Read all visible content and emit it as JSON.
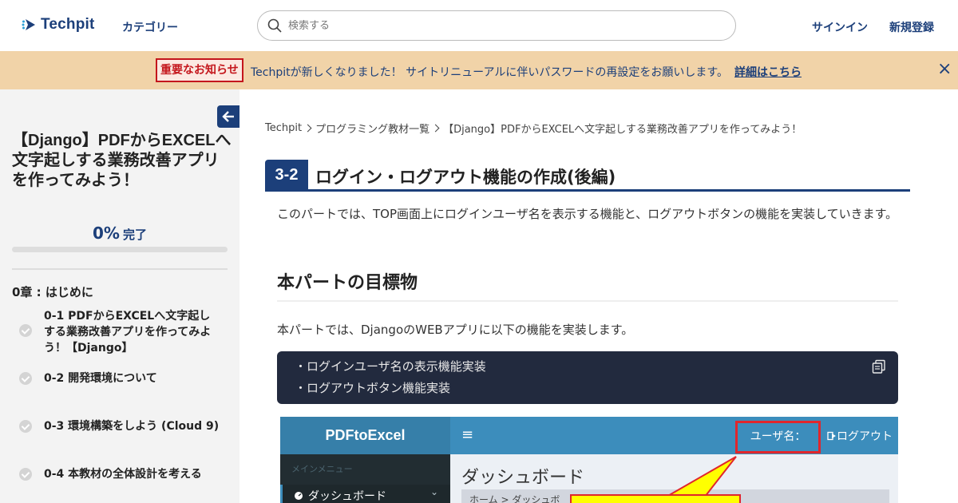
{
  "header": {
    "logo_text": "Techpit",
    "category": "カテゴリー",
    "search_placeholder": "検索する",
    "signin": "サインイン",
    "signup": "新規登録"
  },
  "notice": {
    "badge": "重要なお知らせ",
    "text": "Techpitが新しくなりました！ サイトリニューアルに伴いパスワードの再設定をお願いします。",
    "link": "詳細はこちら",
    "close": "×"
  },
  "sidebar": {
    "course_title": "【Django】PDFからEXCELへ文字起しする業務改善アプリを作ってみよう！",
    "progress_pct": "0%",
    "progress_value": 0,
    "progress_done": "完了",
    "chapter": "0章 : はじめに",
    "lessons": [
      {
        "label": "0-1 PDFからEXCELへ文字起しする業務改善アプリを作ってみよう！【Django】"
      },
      {
        "label": "0-2 開発環境について"
      },
      {
        "label": "0-3 環境構築をしよう (Cloud 9)"
      },
      {
        "label": "0-4 本教材の全体設計を考える"
      }
    ]
  },
  "breadcrumb": {
    "items": [
      "Techpit",
      "プログラミング教材一覧",
      "【Django】PDFからEXCELへ文字起しする業務改善アプリを作ってみよう！"
    ]
  },
  "section": {
    "number": "3-2",
    "title": "ログイン・ログアウト機能の作成(後編)"
  },
  "content": {
    "intro": "このパートでは、TOP画面上にログインユーザ名を表示する機能と、ログアウトボタンの機能を実装していきます。",
    "h2": "本パートの目標物",
    "para2": "本パートでは、DjangoのWEBアプリに以下の機能を実装します。",
    "code_lines": [
      "・ログインユーザ名の表示機能実装",
      "・ログアウトボタン機能実装"
    ]
  },
  "screenshot": {
    "brand": "PDFtoExcel",
    "menu_glyph": "≡",
    "user_label": "ユーザ名：",
    "logout": "ログアウト",
    "main_menu": "メインメニュー",
    "dashboard": "ダッシュボード",
    "heading": "ダッシュボード",
    "crumb": "ホーム > ダッシュボ",
    "accent_red": "#e0262c",
    "callout_yellow": "#ffff00"
  },
  "colors": {
    "brand": "#1c3f7a",
    "notice_bg": "#f1d3a8",
    "code_bg": "#222a3e"
  }
}
